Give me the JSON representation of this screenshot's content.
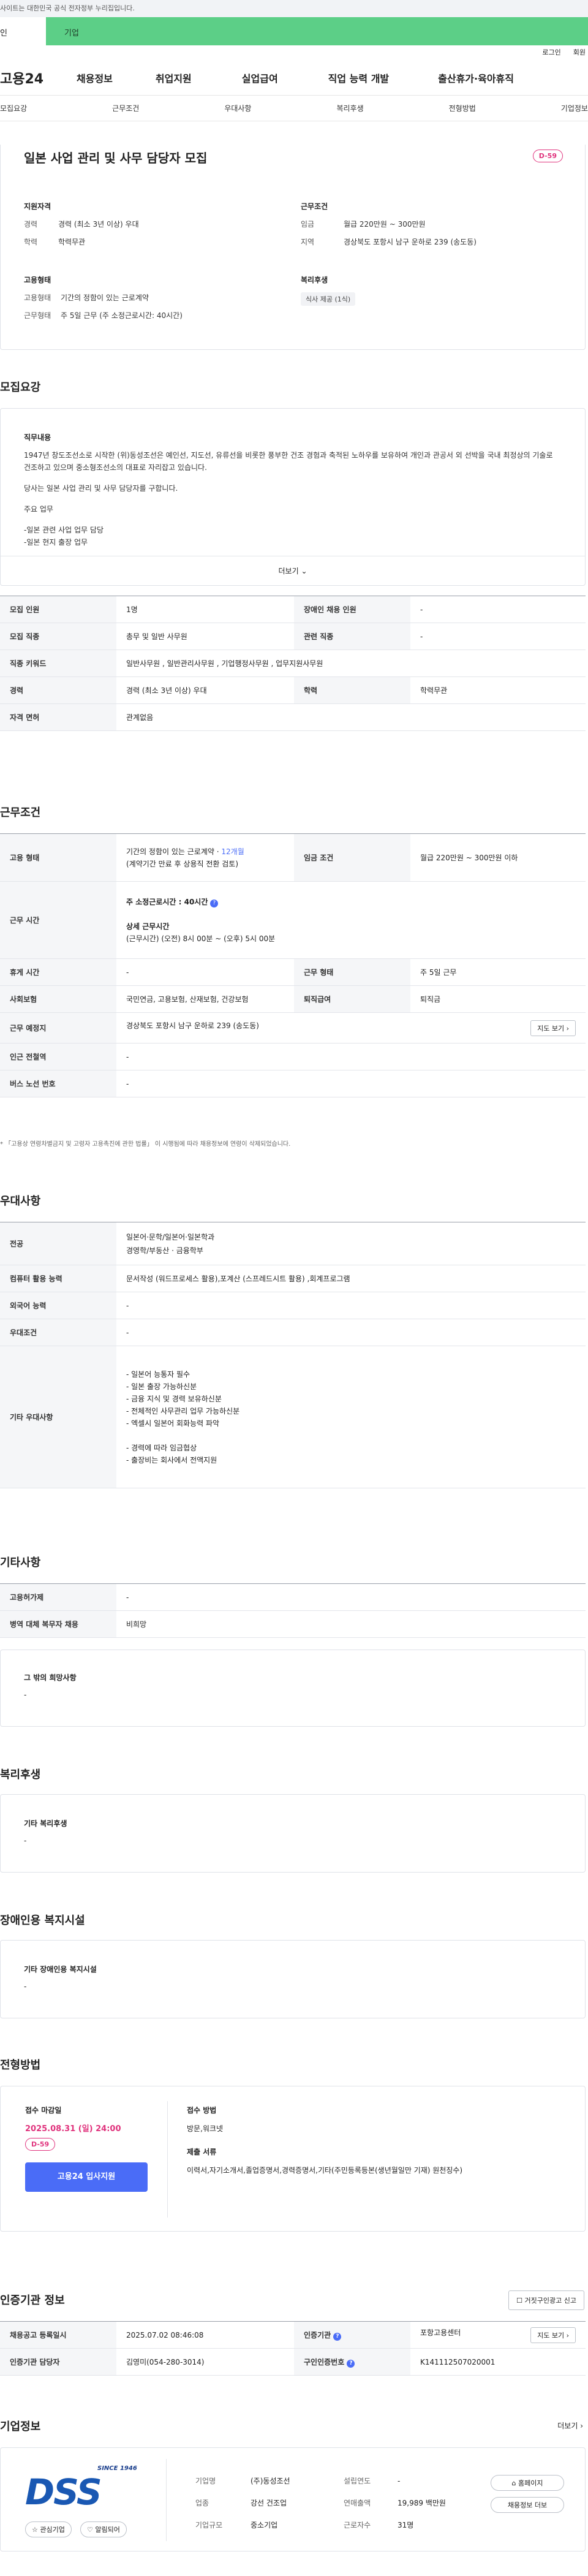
{
  "gov_notice": "사이트는 대한민국 공식 전자정부 누리집입니다.",
  "tabs": {
    "personal": "인",
    "business": "기업"
  },
  "util": [
    "로그인",
    "회원"
  ],
  "logo": "고용24",
  "gnb": [
    "채용정보",
    "취업지원",
    "실업급여",
    "직업 능력 개발",
    "출산휴가·육아휴직"
  ],
  "subnav": [
    "모집요강",
    "근무조건",
    "우대사항",
    "복리후생",
    "전형방법",
    "기업정보"
  ],
  "job": {
    "title": "일본 사업 관리 및 사무 담당자 모집",
    "dday": "D-59",
    "qual_title": "지원자격",
    "qual": [
      {
        "k": "경력",
        "v": "경력 (최소 3년 이상) 우대"
      },
      {
        "k": "학력",
        "v": "학력무관"
      }
    ],
    "cond_title": "근무조건",
    "cond": [
      {
        "k": "임금",
        "v": "월급 220만원 ~ 300만원"
      },
      {
        "k": "지역",
        "v": "경상북도 포항시 남구 운하로 239 (송도동)"
      }
    ],
    "emp_title": "고용형태",
    "emp": [
      {
        "k": "고용형태",
        "v": "기간의 정함이 있는 근로계약"
      },
      {
        "k": "근무형태",
        "v": "주 5일 근무 (주 소정근로시간: 40시간)"
      }
    ],
    "welfare_title": "복리후생",
    "welfare_chip": "식사 제공 (1식)"
  },
  "recruit": {
    "title": "모집요강",
    "duty_title": "직무내용",
    "duty_p1": "1947년 창도조선소로 시작한 (위)동성조선은 예인선, 지도선, 유류선을 비롯한 풍부한 건조 경험과 축적된 노하우를 보유하여 개인과 관공서 외 선박을 국내 최정상의 기술로 건조하고 있으며 중소형조선소의 대표로 자리잡고 있습니다.",
    "duty_p2": "당사는 일본 사업 관리 및 사무 담당자를 구합니다.",
    "duty_p3": "주요 업무",
    "duty_p4": "-일본 관련 사업 업무 담당",
    "duty_p5": "-일본 현지 출장 업무",
    "more": "더보기",
    "rows": [
      {
        "k": "모집 인원",
        "v": "1명",
        "k2": "장애인 채용 인원",
        "v2": "-"
      },
      {
        "k": "모집 직종",
        "v": "총무 및 일반 사무원",
        "k2": "관련 직종",
        "v2": "-"
      },
      {
        "k": "직종 키워드",
        "v": "일반사무원 , 일반관리사무원 , 기업행정사무원 , 업무지원사무원"
      },
      {
        "k": "경력",
        "v": "경력 (최소 3년 이상) 우대",
        "k2": "학력",
        "v2": "학력무관"
      },
      {
        "k": "자격 면허",
        "v": "관계없음"
      }
    ]
  },
  "work": {
    "title": "근무조건",
    "emp_k": "고용 형태",
    "emp_v1": "기간의 정함이 있는 근로계약 ·",
    "emp_v1_hl": "12개월",
    "emp_v2": "(계약기간 만료 후 상용직 전환 검토)",
    "wage_k": "임금 조건",
    "wage_v": "월급 220만원 ~ 300만원 이하",
    "hours_k": "근무 시간",
    "hours_v1": "주 소정근로시간 : 40시간",
    "hours_v2": "상세 근무시간",
    "hours_v3": "(근무시간) (오전) 8시 00분 ~ (오후) 5시 00분",
    "rest_k": "휴게 시간",
    "rest_v": "-",
    "type_k": "근무 형태",
    "type_v": "주 5일 근무",
    "ins_k": "사회보험",
    "ins_v": "국민연금, 고용보험, 산재보험, 건강보험",
    "ret_k": "퇴직급여",
    "ret_v": "퇴직금",
    "place_k": "근무 예정지",
    "place_v": "경상북도 포항시 남구 운하로 239 (송도동)",
    "map_btn": "지도 보기",
    "station_k": "인근 전철역",
    "station_v": "-",
    "bus_k": "버스 노선 번호",
    "bus_v": "-",
    "note": "* 「고용상 연령차별금지 및 고령자 고용촉진에 관한 법률」 이 시행됨에 따라 채용정보에 연령이 삭제되었습니다."
  },
  "pref": {
    "title": "우대사항",
    "major_k": "전공",
    "major_v1": "일본어·문학/일본어·일본학과",
    "major_v2": "경영학/부동산 · 금융학부",
    "pc_k": "컴퓨터 활용 능력",
    "pc_v": "문서작성 (워드프로세스 활용),포계산 (스프레드시트 활용) ,회계프로그램",
    "lang_k": "외국어 능력",
    "lang_v": "-",
    "cond_k": "우대조건",
    "cond_v": "-",
    "etc_k": "기타 우대사항",
    "etc_v": [
      "- 일본어 능통자 필수",
      "- 일본 출장 가능하신분",
      "- 금융 지식 및 경력 보유하신분",
      "- 전체적인 사무관리 업무 가능하신분",
      "- 엑셀시 일본어 회화능력 파악",
      "",
      "- 경력에 따라 임금협상",
      "- 출장비는 회사에서 전액지원"
    ]
  },
  "other": {
    "title": "기타사항",
    "need_k": "고용허가제",
    "need_v": "-",
    "military_k": "병역 대체 복무자 채용",
    "military_v": "비희망",
    "hope_title": "그 밖의 희망사항",
    "hope_v": "-"
  },
  "welfare": {
    "title": "복리후생",
    "box_title": "기타 복리후생",
    "box_v": "-"
  },
  "disabled": {
    "title": "장애인용 복지시설",
    "box_title": "기타 장애인용 복지시설",
    "box_v": "-"
  },
  "process": {
    "title": "전형방법",
    "deadline_h": "접수 마감일",
    "deadline": "2025.08.31 (일) 24:00",
    "dday": "D-59",
    "apply_btn": "고용24 입사지원",
    "method_h": "접수 방법",
    "method_v": "방문,워크넷",
    "docs_h": "제출 서류",
    "docs_v": "이력서,자기소개서,졸업증명서,경력증명서,기타(주민등록등본(생년월일만 기재) 원천징수)"
  },
  "agency": {
    "title": "인증기관 정보",
    "report_btn": "거짓구인광고 신고",
    "reg_k": "채용공고 등록일시",
    "reg_v": "2025.07.02 08:46:08",
    "agency_k": "인증기관",
    "agency_v": "포항고용센터",
    "map_btn": "지도 보기",
    "mgr_k": "인증기관 담당자",
    "mgr_v": "김영미(054-280-3014)",
    "num_k": "구인인증번호",
    "num_v": "K141112507020001"
  },
  "company": {
    "title": "기업정보",
    "more": "더보기",
    "logo_text": "DSS",
    "logo_since": "SINCE 1946",
    "fav_btn": "관심기업",
    "alarm_btn": "알림되어",
    "name_k": "기업명",
    "name_v": "(주)동성조선",
    "est_k": "설립연도",
    "est_v": "-",
    "ind_k": "업종",
    "ind_v": "강선 건조업",
    "sales_k": "연매출액",
    "sales_v": "19,989 백만원",
    "size_k": "기업규모",
    "size_v": "중소기업",
    "emp_k": "근로자수",
    "emp_v": "31명",
    "home_btn": "홈페이지",
    "more_info_btn": "채용정보 더보"
  },
  "colors": {
    "green": "#5ccf87",
    "pink": "#e0337d",
    "blue": "#4a6cf7"
  }
}
